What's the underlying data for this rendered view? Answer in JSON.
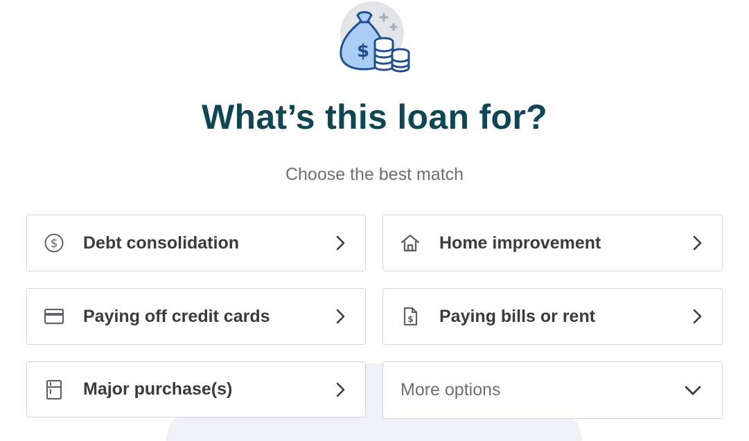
{
  "header": {
    "icon": "money-bag-icon",
    "title": "What’s this loan for?",
    "subtitle": "Choose the best match"
  },
  "options": [
    {
      "label": "Debt consolidation",
      "icon": "dollar-circle-icon"
    },
    {
      "label": "Home improvement",
      "icon": "house-icon"
    },
    {
      "label": "Paying off credit cards",
      "icon": "credit-card-icon"
    },
    {
      "label": "Paying bills or rent",
      "icon": "bill-document-icon"
    },
    {
      "label": "Major purchase(s)",
      "icon": "appliance-icon"
    }
  ],
  "more": {
    "label": "More options",
    "icon": "chevron-down-icon"
  },
  "colors": {
    "title": "#0f4653",
    "subtitle": "#6f6f6f",
    "label": "#3b3b3b",
    "border": "#d3d6da",
    "icon_blue": "#a9cdf5",
    "icon_outline": "#1f4f8f"
  }
}
